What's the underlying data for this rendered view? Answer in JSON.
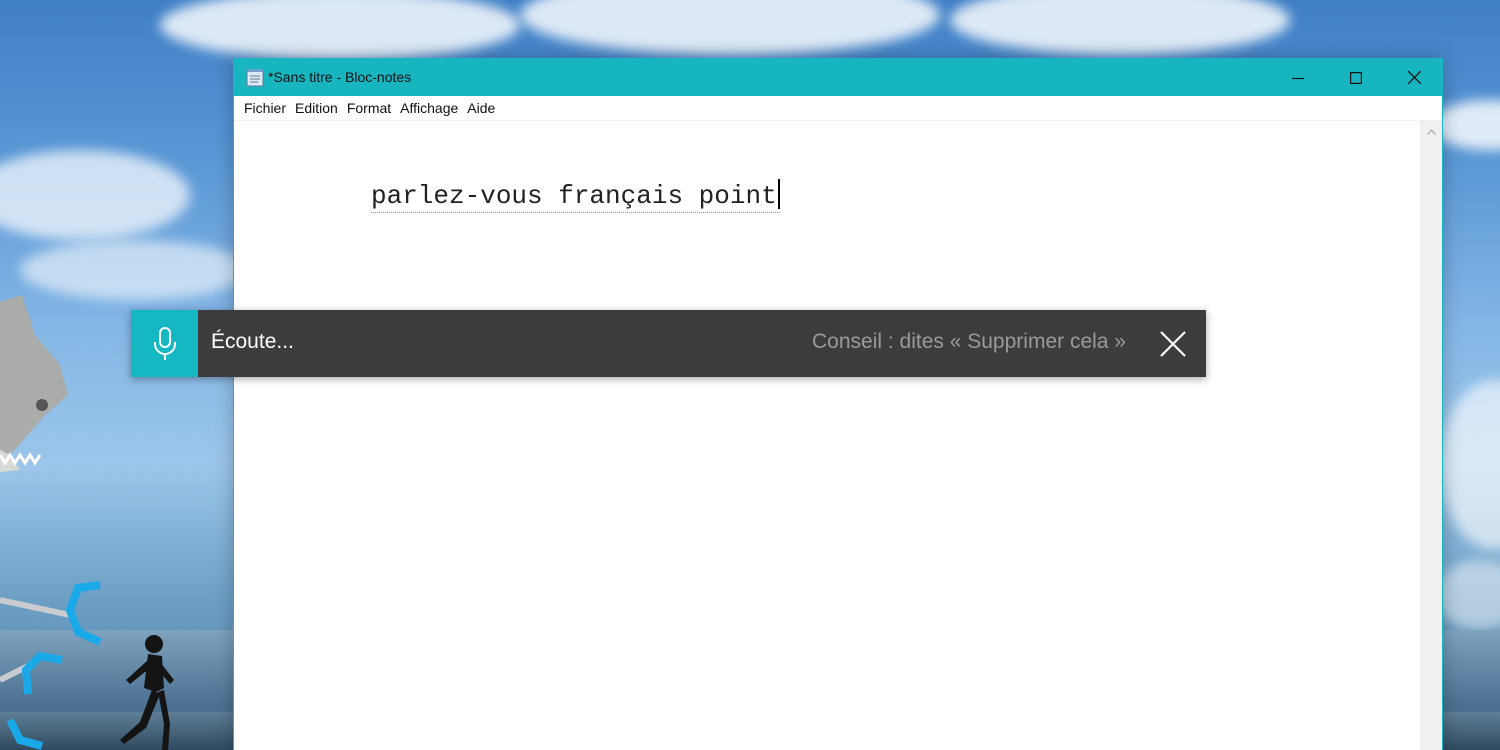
{
  "window": {
    "title": "*Sans titre - Bloc-notes",
    "accent_color": "#17b5c0",
    "controls": {
      "minimize": "minimize-icon",
      "maximize": "maximize-icon",
      "close": "close-icon"
    }
  },
  "menu": {
    "items": [
      "Fichier",
      "Edition",
      "Format",
      "Affichage",
      "Aide"
    ]
  },
  "editor": {
    "content": "parlez-vous français point"
  },
  "dictation": {
    "status": "Écoute...",
    "hint": "Conseil : dites « Supprimer cela »",
    "mic_color": "#15b7c3",
    "bar_color": "#3c3c3c",
    "icons": {
      "mic": "microphone-icon",
      "close": "close-icon"
    }
  }
}
